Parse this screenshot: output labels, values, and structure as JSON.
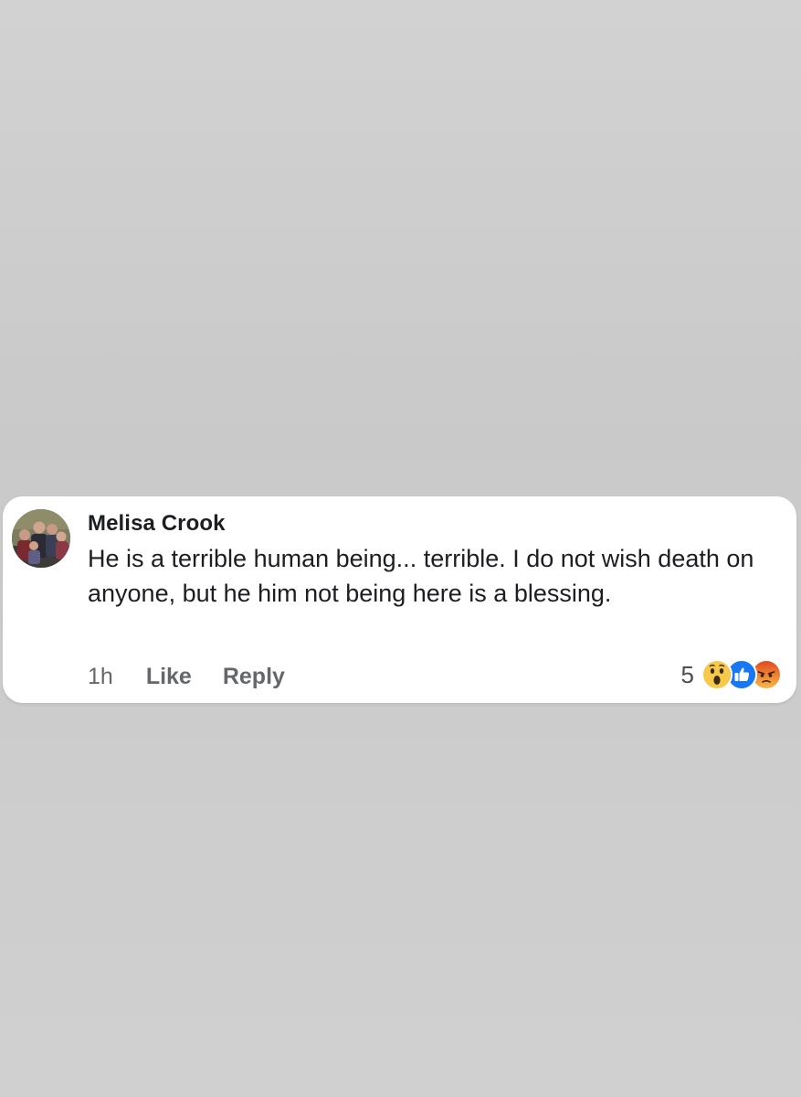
{
  "comment": {
    "author": "Melisa Crook",
    "text": "He is a terrible human being... terrible. I do not wish death on anyone, but he him not being here is a blessing.",
    "time": "1h",
    "like_label": "Like",
    "reply_label": "Reply",
    "reaction_count": "5",
    "reactions": [
      "wow-icon",
      "like-icon",
      "angry-icon"
    ]
  },
  "colors": {
    "background": "#cfcfcf",
    "card": "#ffffff",
    "text": "#1c1e21",
    "secondary_text": "#65676b",
    "like_blue": "#1877f2",
    "wow_yellow": "#f7c94b",
    "angry_orange": "#e9710f"
  }
}
